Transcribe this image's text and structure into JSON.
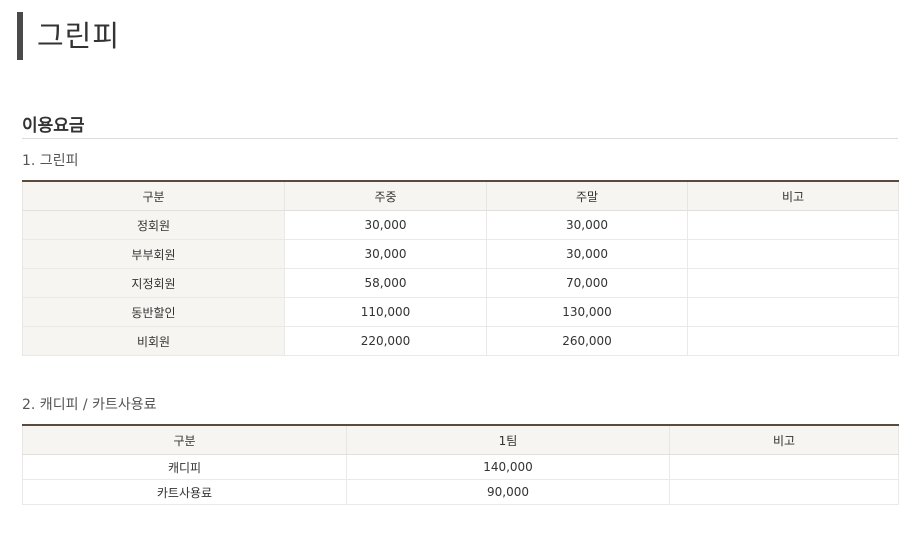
{
  "page": {
    "title": "그린피"
  },
  "section": {
    "title": "이용요금"
  },
  "green_fee": {
    "subtitle": "1. 그린피",
    "headers": [
      "구분",
      "주중",
      "주말",
      "비고"
    ],
    "rows": [
      [
        "정회원",
        "30,000",
        "30,000",
        ""
      ],
      [
        "부부회원",
        "30,000",
        "30,000",
        ""
      ],
      [
        "지정회원",
        "58,000",
        "70,000",
        ""
      ],
      [
        "동반할인",
        "110,000",
        "130,000",
        ""
      ],
      [
        "비회원",
        "220,000",
        "260,000",
        ""
      ]
    ]
  },
  "caddy_fee": {
    "subtitle": "2. 캐디피 / 카트사용료",
    "headers": [
      "구분",
      "1팀",
      "비고"
    ],
    "rows": [
      [
        "캐디피",
        "140,000",
        ""
      ],
      [
        "카트사용료",
        "90,000",
        ""
      ]
    ]
  }
}
